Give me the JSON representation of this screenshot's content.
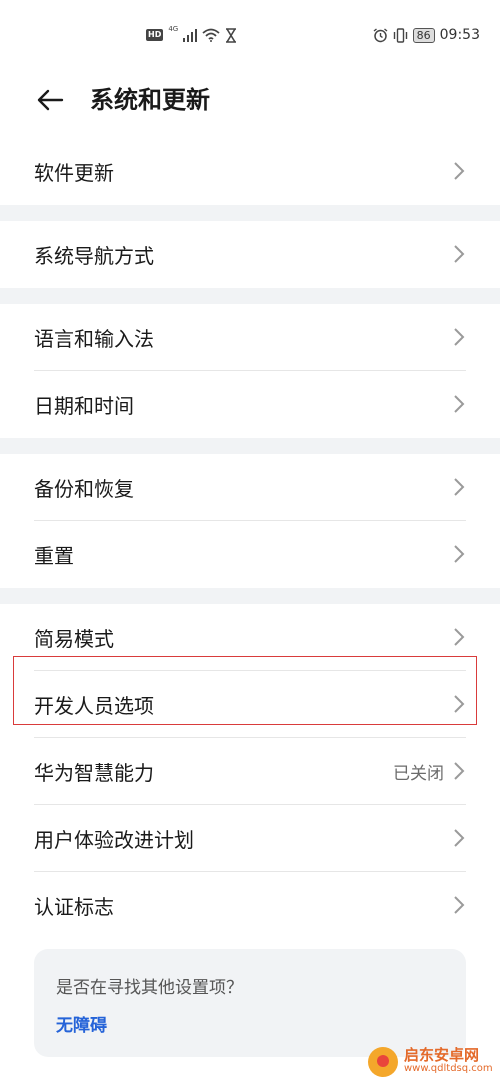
{
  "status_bar": {
    "left_icons": [
      "hd-icon",
      "signal-4g-icon",
      "wifi-icon",
      "hourglass-icon"
    ],
    "hd_label": "HD",
    "network_label": "4G",
    "alarm_icon": "alarm-icon",
    "vibrate_icon": "vibrate-icon",
    "battery": "86",
    "time": "09:53"
  },
  "header": {
    "back_icon": "arrow-left-icon",
    "title": "系统和更新"
  },
  "groups": [
    {
      "items": [
        {
          "label": "软件更新"
        }
      ]
    },
    {
      "items": [
        {
          "label": "系统导航方式"
        }
      ]
    },
    {
      "items": [
        {
          "label": "语言和输入法"
        },
        {
          "label": "日期和时间"
        }
      ]
    },
    {
      "items": [
        {
          "label": "备份和恢复"
        },
        {
          "label": "重置"
        }
      ]
    },
    {
      "items": [
        {
          "label": "简易模式"
        },
        {
          "label": "开发人员选项",
          "highlighted": true
        },
        {
          "label": "华为智慧能力",
          "value": "已关闭"
        },
        {
          "label": "用户体验改进计划"
        },
        {
          "label": "认证标志"
        }
      ]
    }
  ],
  "suggestion": {
    "question": "是否在寻找其他设置项？",
    "link": "无障碍"
  },
  "watermark": {
    "name": "启东安卓网",
    "url": "www.qdltdsq.com"
  },
  "colors": {
    "background": "#ffffff",
    "separator": "#f1f3f5",
    "link": "#2563d8",
    "highlight_border": "#d93b3b",
    "secondary_text": "#6b6b6b"
  }
}
